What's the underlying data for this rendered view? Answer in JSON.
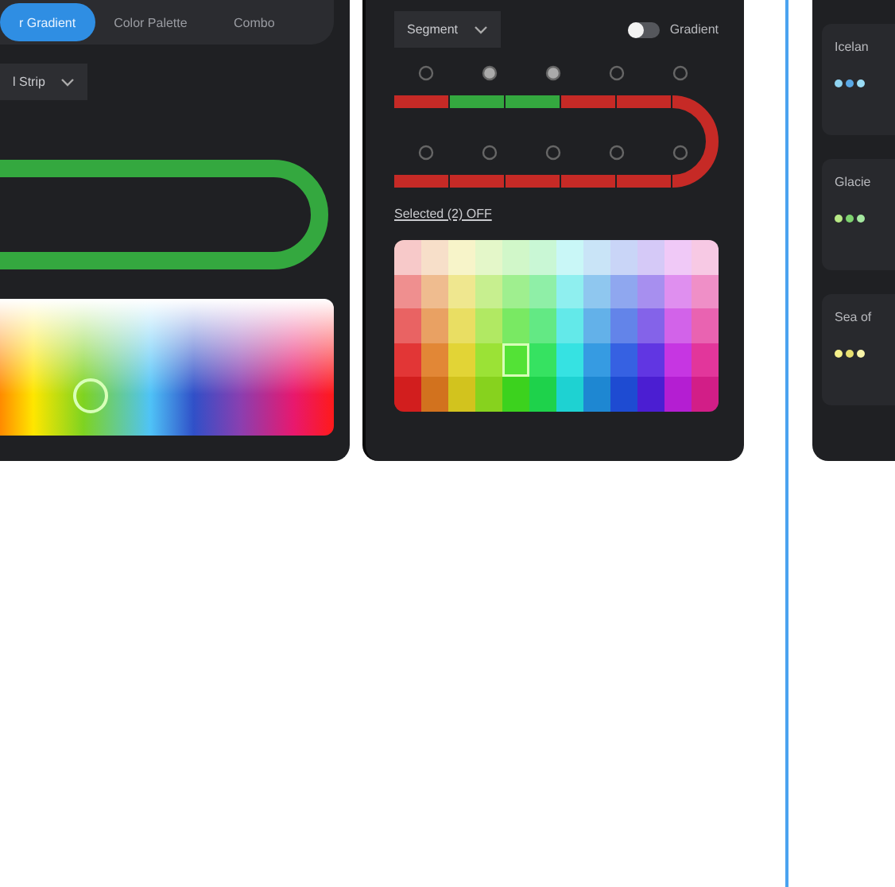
{
  "gradient_panel": {
    "tabs": [
      {
        "label": "r Gradient",
        "selected": true
      },
      {
        "label": "Color Palette",
        "selected": false
      },
      {
        "label": "Combo",
        "selected": false
      }
    ],
    "dropdown": "l Strip",
    "picker": {
      "level": 0.27
    }
  },
  "segment_panel": {
    "dropdown": "Segment",
    "toggle": {
      "label": "Gradient",
      "on": false
    },
    "top_segments": [
      {
        "selected": false
      },
      {
        "selected": true
      },
      {
        "selected": true
      },
      {
        "selected": false
      },
      {
        "selected": false
      }
    ],
    "bottom_segments": [
      {
        "selected": false
      },
      {
        "selected": false
      },
      {
        "selected": false
      },
      {
        "selected": false
      },
      {
        "selected": false
      }
    ],
    "status": "Selected (2) OFF",
    "palette_rows": [
      [
        {
          "selected": false
        },
        {
          "selected": false
        },
        {
          "selected": false
        },
        {
          "selected": false
        },
        {
          "selected": false
        },
        {
          "selected": false
        },
        {
          "selected": false
        },
        {
          "selected": false
        },
        {
          "selected": false
        },
        {
          "selected": false
        },
        {
          "selected": false
        },
        {
          "selected": false
        }
      ],
      [
        {
          "selected": false
        },
        {
          "selected": false
        },
        {
          "selected": false
        },
        {
          "selected": false
        },
        {
          "selected": false
        },
        {
          "selected": false
        },
        {
          "selected": false
        },
        {
          "selected": false
        },
        {
          "selected": false
        },
        {
          "selected": false
        },
        {
          "selected": false
        },
        {
          "selected": false
        }
      ],
      [
        {
          "selected": false
        },
        {
          "selected": false
        },
        {
          "selected": false
        },
        {
          "selected": false
        },
        {
          "selected": false
        },
        {
          "selected": false
        },
        {
          "selected": false
        },
        {
          "selected": false
        },
        {
          "selected": false
        },
        {
          "selected": false
        },
        {
          "selected": false
        },
        {
          "selected": false
        }
      ],
      [
        {
          "selected": false
        },
        {
          "selected": false
        },
        {
          "selected": false
        },
        {
          "selected": false
        },
        {
          "selected": true
        },
        {
          "selected": false
        },
        {
          "selected": false
        },
        {
          "selected": false
        },
        {
          "selected": false
        },
        {
          "selected": false
        },
        {
          "selected": false
        },
        {
          "selected": false
        }
      ],
      [
        {
          "selected": false
        },
        {
          "selected": false
        },
        {
          "selected": false
        },
        {
          "selected": false
        },
        {
          "selected": false
        },
        {
          "selected": false
        },
        {
          "selected": false
        },
        {
          "selected": false
        },
        {
          "selected": false
        },
        {
          "selected": false
        },
        {
          "selected": false
        },
        {
          "selected": false
        }
      ]
    ]
  },
  "scene_panel": {
    "scenes": [
      {
        "name": "Icelan",
        "dots": [
          {
            "color": "#8fd3f0"
          },
          {
            "color": "#5aa9e6"
          },
          {
            "color": "#9adcf5"
          }
        ]
      },
      {
        "name": "Glacie",
        "dots": [
          {
            "color": "#b8e986"
          },
          {
            "color": "#7ed36f"
          },
          {
            "color": "#a5e8a0"
          }
        ]
      },
      {
        "name": "Sea of",
        "dots": [
          {
            "color": "#f5f08a"
          },
          {
            "color": "#e8e070"
          },
          {
            "color": "#f8f4a8"
          }
        ]
      }
    ]
  }
}
